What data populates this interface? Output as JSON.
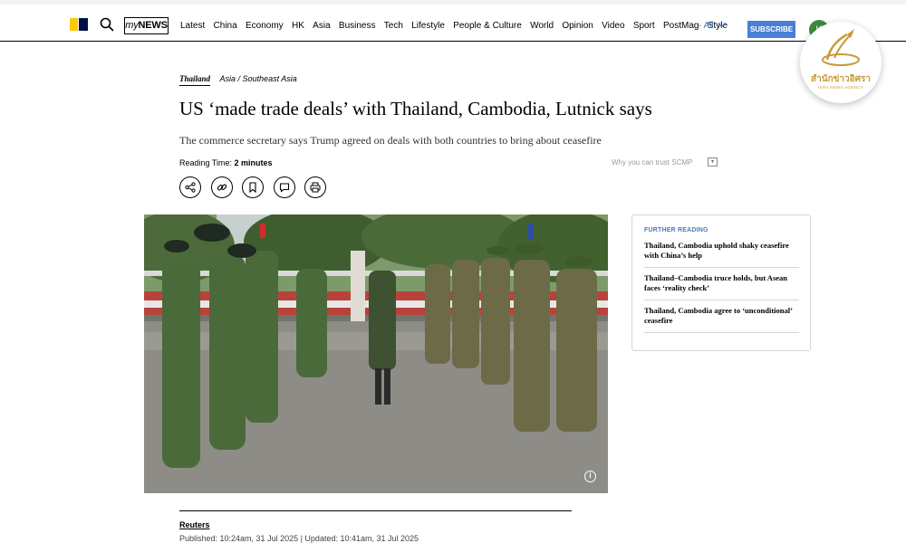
{
  "nav": {
    "logo": "South China Morning Post",
    "mynews_prefix": "my",
    "mynews_suffix": "NEWS",
    "links": [
      "Latest",
      "China",
      "Economy",
      "HK",
      "Asia",
      "Business",
      "Tech",
      "Lifestyle",
      "People & Culture",
      "World",
      "Opinion",
      "Video",
      "Sport",
      "PostMag",
      "Style"
    ],
    "all_label": "- All",
    "subscribe_label": "SUBSCRIBE",
    "avatar_initial": "K",
    "icons": {
      "search": "search-icon",
      "all": "chevron-down-icon"
    }
  },
  "watermark": {
    "thai_text": "สำนักข่าวอิศรา",
    "english_text": "ISRA NEWS AGENCY"
  },
  "article": {
    "section": "Thailand",
    "subsection": "Asia / Southeast Asia",
    "headline": "US ‘made trade deals’ with Thailand, Cambodia, Lutnick says",
    "subhead": "The commerce secretary says Trump agreed on deals with both countries to bring about ceasefire",
    "reading_time_label": "Reading Time:",
    "reading_time_value": "2 minutes",
    "trust_label": "Why you can trust SCMP",
    "action_icons": [
      "share-icon",
      "link-icon",
      "bookmark-icon",
      "comment-icon",
      "print-icon"
    ]
  },
  "further_reading": {
    "title": "FURTHER READING",
    "items": [
      "Thailand, Cambodia uphold shaky ceasefire with China’s help",
      "Thailand–Cambodia truce holds, but Asean faces ‘reality check’",
      "Thailand, Cambodia agree to ‘unconditional’ ceasefire"
    ]
  },
  "byline": {
    "author": "Reuters",
    "published": "Published: 10:24am, 31 Jul 2025 | Updated: 10:41am, 31 Jul 2025"
  },
  "colors": {
    "logo_yellow": "#ffca05",
    "logo_navy": "#001246",
    "accent_blue": "#4a7bbc",
    "subscribe_blue": "#4a7fd6",
    "avatar_green": "#3c8a3c",
    "watermark_gold": "#c99a3a"
  }
}
